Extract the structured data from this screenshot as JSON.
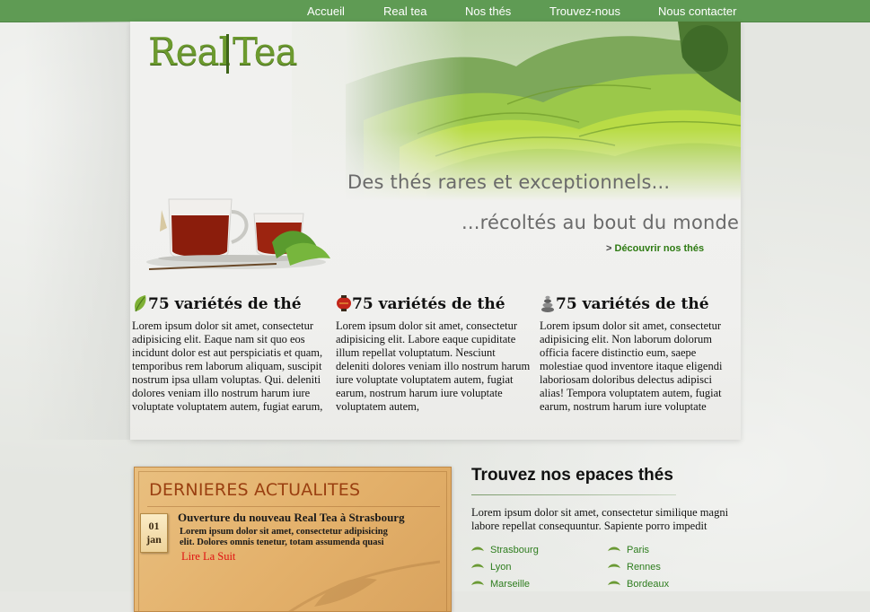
{
  "nav": {
    "items": [
      {
        "label": "Accueil"
      },
      {
        "label": "Real tea"
      },
      {
        "label": "Nos thés"
      },
      {
        "label": "Trouvez-nous"
      },
      {
        "label": "Nous contacter"
      }
    ]
  },
  "hero": {
    "logo_text_left": "Real",
    "logo_text_right": "Tea",
    "tagline1": "Des thés rares et exceptionnels...",
    "tagline2": "...récoltés au bout du monde",
    "cta_arrow": ">",
    "cta_label": "Découvrir nos thés"
  },
  "features": [
    {
      "icon": "leaf-icon",
      "title": "75 variétés de thé",
      "text": "Lorem ipsum dolor sit amet, consectetur adipisicing elit. Eaque nam sit quo eos incidunt dolor est aut perspiciatis et quam, temporibus rem laborum aliquam, suscipit nostrum ipsa ullam voluptas. Qui. deleniti dolores veniam illo nostrum harum iure voluptate voluptatem autem, fugiat earum,"
    },
    {
      "icon": "lantern-icon",
      "title": "75 variétés de thé",
      "text": "Lorem ipsum dolor sit amet, consectetur adipisicing elit. Labore eaque cupiditate illum repellat voluptatum. Nesciunt deleniti dolores veniam illo nostrum harum iure voluptate voluptatem autem, fugiat earum, nostrum harum iure voluptate voluptatem autem,"
    },
    {
      "icon": "stones-icon",
      "title": "75 variétés de thé",
      "text": "Lorem ipsum dolor sit amet, consectetur adipisicing elit. Non laborum dolorum officia facere distinctio eum, saepe molestiae quod inventore itaque eligendi laboriosam doloribus delectus adipisci alias! Tempora voluptatem autem, fugiat earum, nostrum harum iure voluptate"
    }
  ],
  "news": {
    "title": "DERNIERES ACTUALITES",
    "date_day": "01",
    "date_month": "jan",
    "headline": "Ouverture du nouveau Real Tea à Strasbourg",
    "body": "Lorem ipsum dolor sit amet, consectetur adipisicing elit. Dolores omnis tenetur, totam assumenda quasi",
    "more": "Lire La Suit"
  },
  "spaces": {
    "title": "Trouvez nos epaces thés",
    "description": "Lorem ipsum dolor sit amet, consectetur similique magni labore repellat consequuntur. Sapiente porro impedit",
    "cities_left": [
      "Strasbourg",
      "Lyon",
      "Marseille"
    ],
    "cities_right": [
      "Paris",
      "Rennes",
      "Bordeaux"
    ]
  },
  "colors": {
    "nav_bg": "#5f9b54",
    "link_green": "#2e7d1e",
    "news_title": "#9a3f10",
    "news_more": "#e01010"
  }
}
